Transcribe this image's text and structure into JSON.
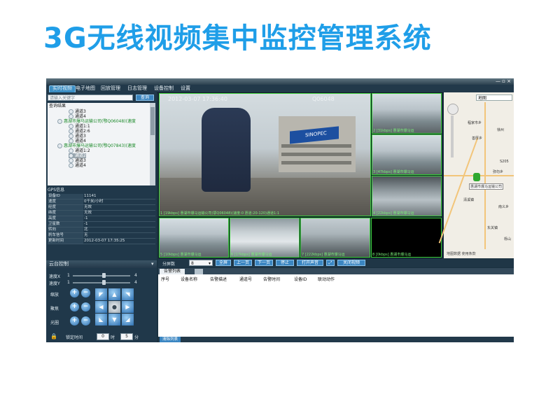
{
  "slide": {
    "title": "3G无线视频集中监控管理系统"
  },
  "app": {
    "title": "",
    "window_buttons": "— ▫ ×",
    "menu": [
      {
        "label": "实时视频",
        "active": true
      },
      {
        "label": "电子地图"
      },
      {
        "label": "回放管理"
      },
      {
        "label": "日志管理"
      },
      {
        "label": "设备控制"
      },
      {
        "label": "设置"
      }
    ],
    "search": {
      "placeholder": "请输入关键字",
      "button": "查询"
    },
    "tree": {
      "root": "查询结果",
      "items": [
        {
          "label": "通道3",
          "style": ""
        },
        {
          "label": "通道4",
          "style": ""
        },
        {
          "label": "惠湖市爆马运输公司(鄂Q06048)(速度",
          "style": "green"
        },
        {
          "label": "通道1:1",
          "style": ""
        },
        {
          "label": "通道2:6",
          "style": ""
        },
        {
          "label": "通道3",
          "style": ""
        },
        {
          "label": "通道4",
          "style": ""
        },
        {
          "label": "惠湖市爆马运输公司(鄂Q07843)(速度",
          "style": "green"
        },
        {
          "label": "通道1:2",
          "style": ""
        },
        {
          "label": "通道2",
          "style": "sel"
        },
        {
          "label": "通道3",
          "style": ""
        },
        {
          "label": "通道4",
          "style": ""
        }
      ]
    },
    "gps": {
      "header": "GPS信息",
      "rows": [
        {
          "k": "设备ID",
          "v": "11141"
        },
        {
          "k": "速度",
          "v": "0千米/小时"
        },
        {
          "k": "经度",
          "v": "无效"
        },
        {
          "k": "纬度",
          "v": "无效"
        },
        {
          "k": "高度",
          "v": "-1"
        },
        {
          "k": "卫星数",
          "v": "-1"
        },
        {
          "k": "转向",
          "v": "北"
        },
        {
          "k": "刹车信号",
          "v": "无"
        },
        {
          "k": "更新时间",
          "v": "2012-03-07 17:35:25"
        }
      ]
    },
    "ptz": {
      "header": "云台控制",
      "speed_x_label": "速度X",
      "speed_y_label": "速度Y",
      "speed_x_min": "1",
      "speed_x_max": "4",
      "speed_y_min": "1",
      "speed_y_max": "4",
      "speed_x_value": 0.55,
      "speed_y_value": 0.55,
      "zoom_label": "缩放",
      "focus_label": "聚焦",
      "iris_label": "光圈",
      "lock_label": "锁定时间",
      "lock_hours": "0",
      "lock_hours_unit": "时",
      "lock_minutes": "5",
      "lock_minutes_unit": "分"
    },
    "video": {
      "main_osd_time": "2012-03-07 17:36:40",
      "main_osd_id": "Q06048",
      "main_station_sign": "SINOPEC",
      "main_caption": "1 [19kbps] 惠湖市爆马运输公司(鄂Q06048)(速度:0 愿道:20-120)通道1:1",
      "tiles": [
        {
          "caption": "2 [31kbps] 惠湖市爆马运"
        },
        {
          "caption": "3 [47kbps] 惠湖市爆马运"
        },
        {
          "caption": "4 [22kbps] 惠湖市爆马运"
        },
        {
          "caption": "5 [10kbps] 惠湖市爆马运"
        },
        {
          "caption": "6 [17kbps] 惠湖市爆马运"
        },
        {
          "caption": "7 [222kbps] 惠湖市爆马运"
        },
        {
          "caption": "8 [0kbps] 惠湖市爆马运"
        }
      ]
    },
    "map": {
      "dropdown": "地图",
      "labels": [
        "程家市乡",
        "善厚乡",
        "徐州",
        "S205",
        "弥勿乡",
        "惠湖市爆马运输公司",
        "清溪镇",
        "南义乡",
        "东关镇",
        "栎山"
      ],
      "footer": "地图数据 使用条款"
    },
    "controls": {
      "split_label": "分屏数",
      "split_value": "8",
      "buttons": [
        "全屏",
        "上一页",
        "下一页",
        "停止",
        "打开声音",
        "⤢",
        "关闭视频"
      ]
    },
    "alarm": {
      "tab": "告警列表",
      "columns": [
        "序号",
        "设备名称",
        "告警描述",
        "通道号",
        "告警时间",
        "设备ID",
        "联动动作"
      ],
      "footer_button": "清除列表"
    }
  }
}
